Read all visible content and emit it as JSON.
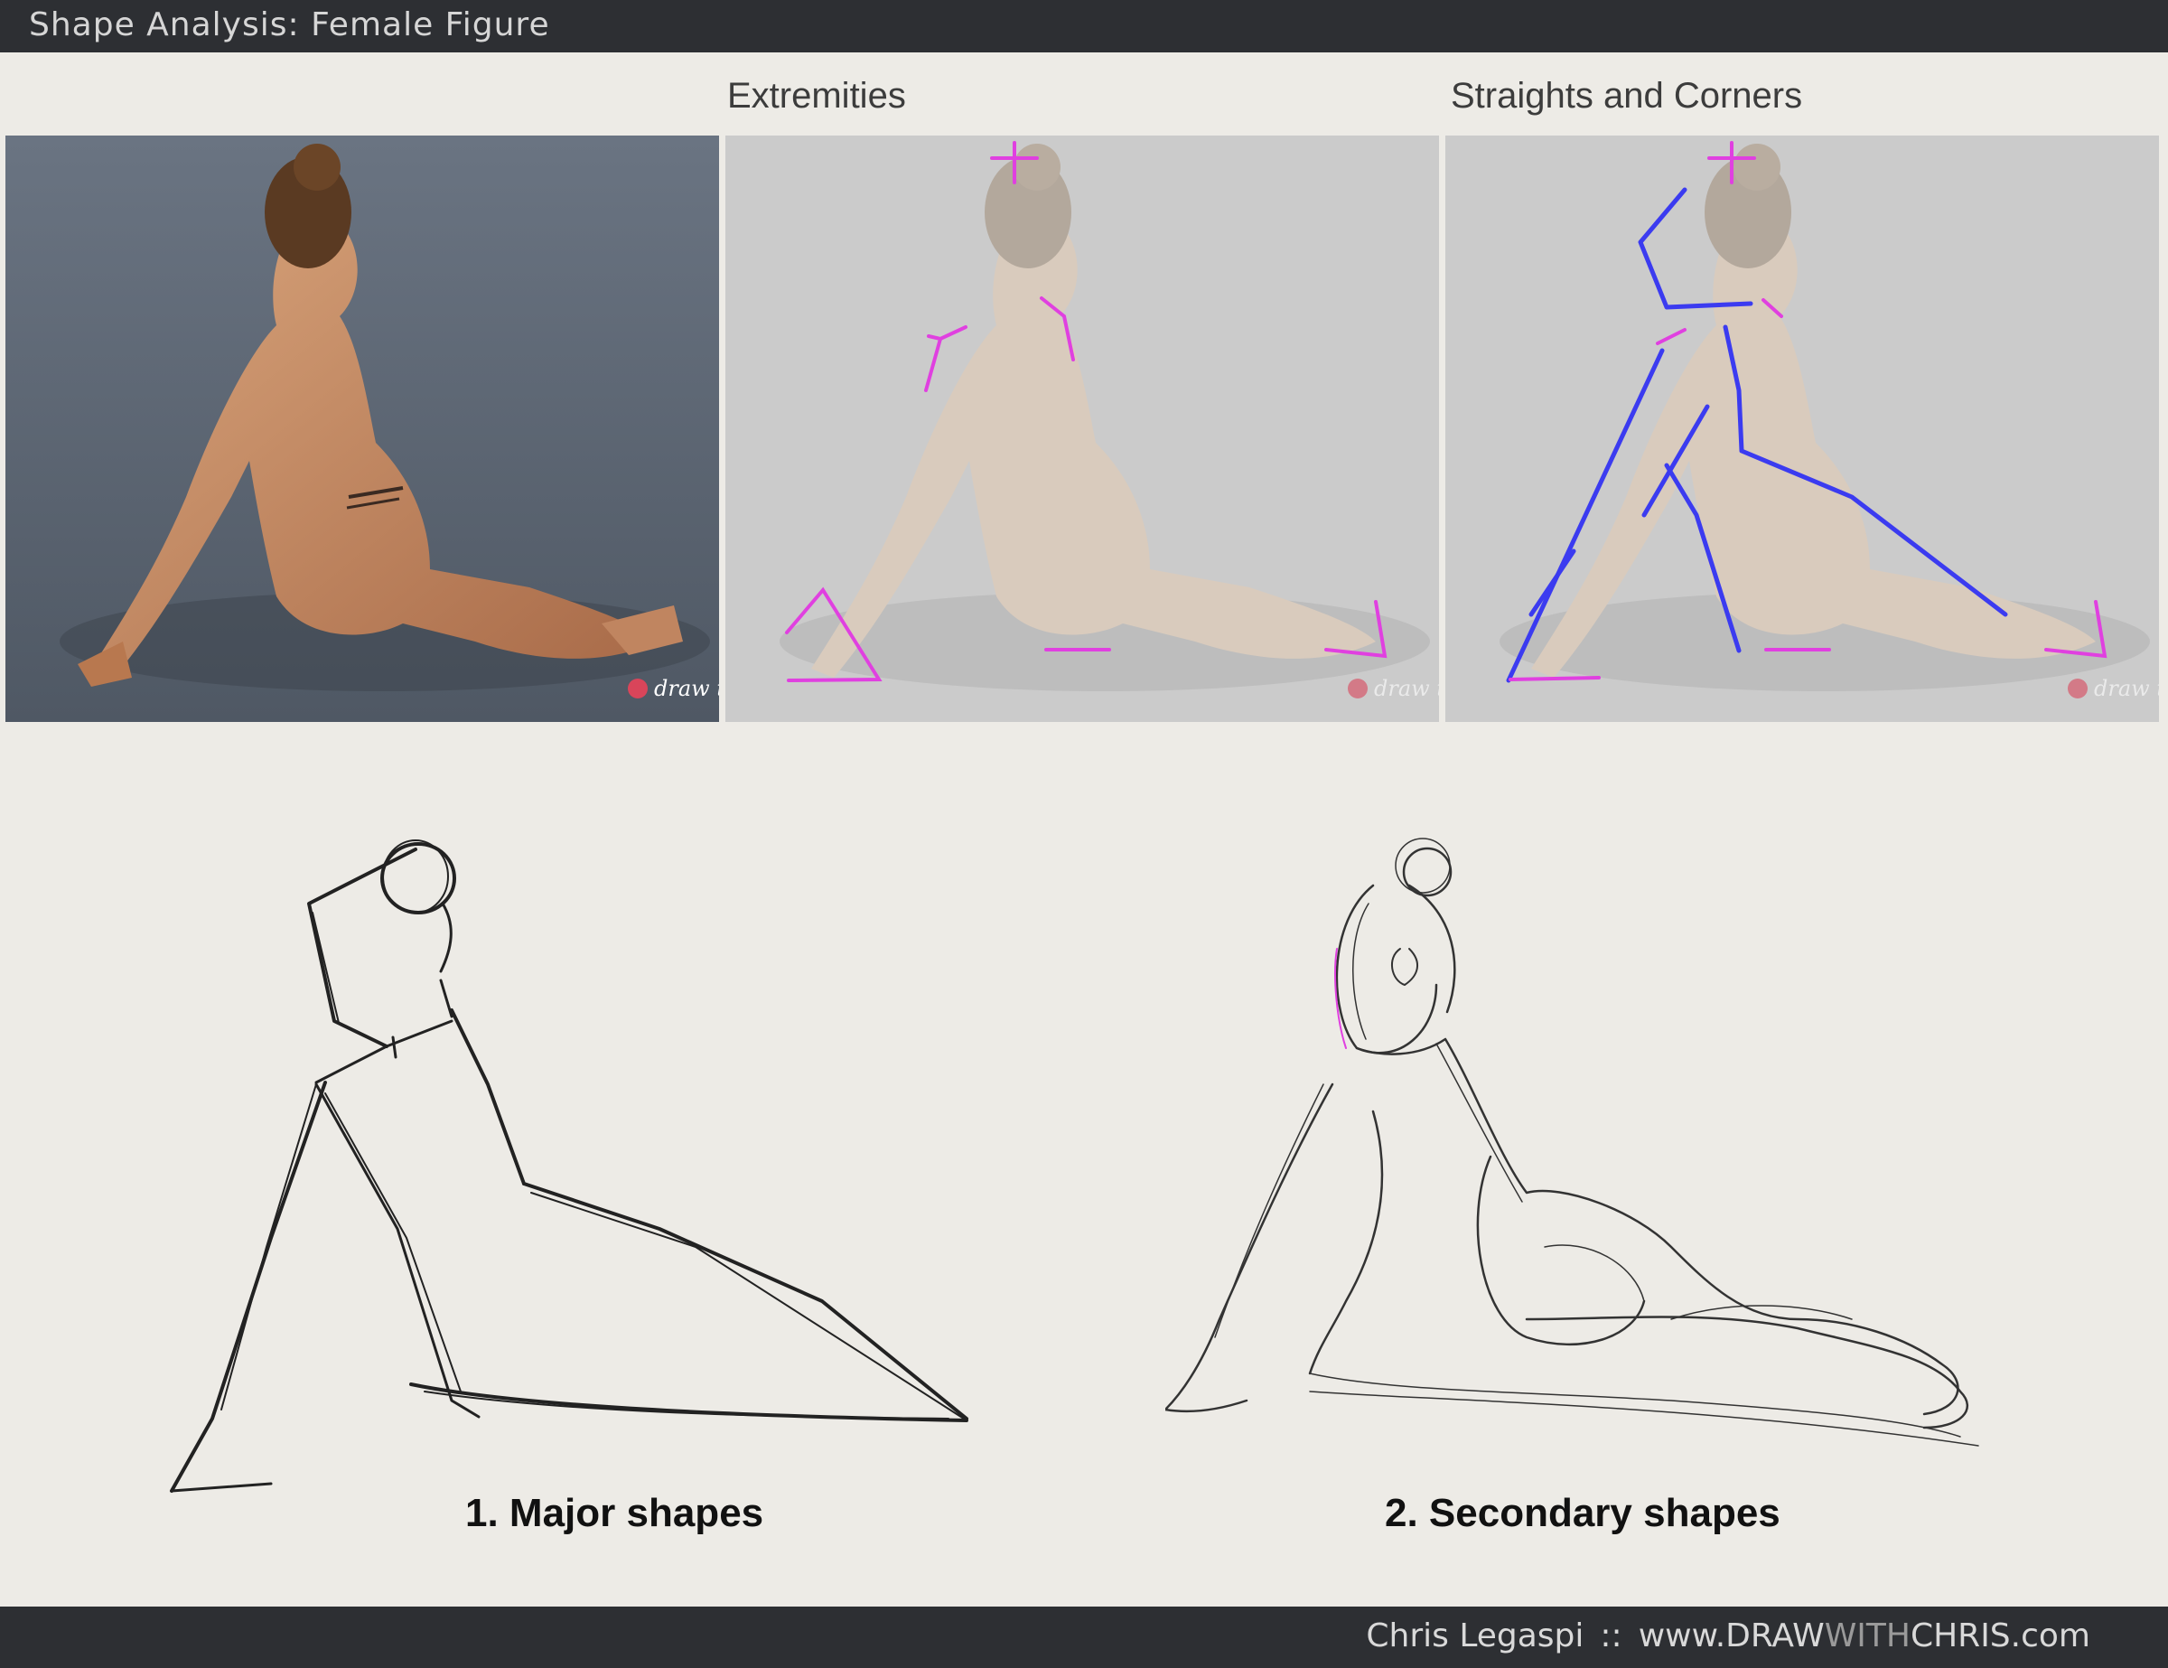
{
  "header": {
    "title": "Shape Analysis: Female Figure"
  },
  "panels": {
    "extremities_title": "Extremities",
    "straights_title": "Straights and Corners",
    "watermark": "draw this"
  },
  "captions": {
    "major": "1. Major shapes",
    "secondary": "2. Secondary shapes"
  },
  "footer": {
    "author": "Chris Legaspi",
    "separator": "::",
    "url_prefix": "www.DRAW",
    "url_highlight": "WITH",
    "url_suffix": "CHRIS.com"
  },
  "colors": {
    "marker_magenta": "#e040e0",
    "marker_blue": "#3b3bf0",
    "photo_bg": "#5d6775",
    "faded_bg": "#c9c9c9"
  }
}
